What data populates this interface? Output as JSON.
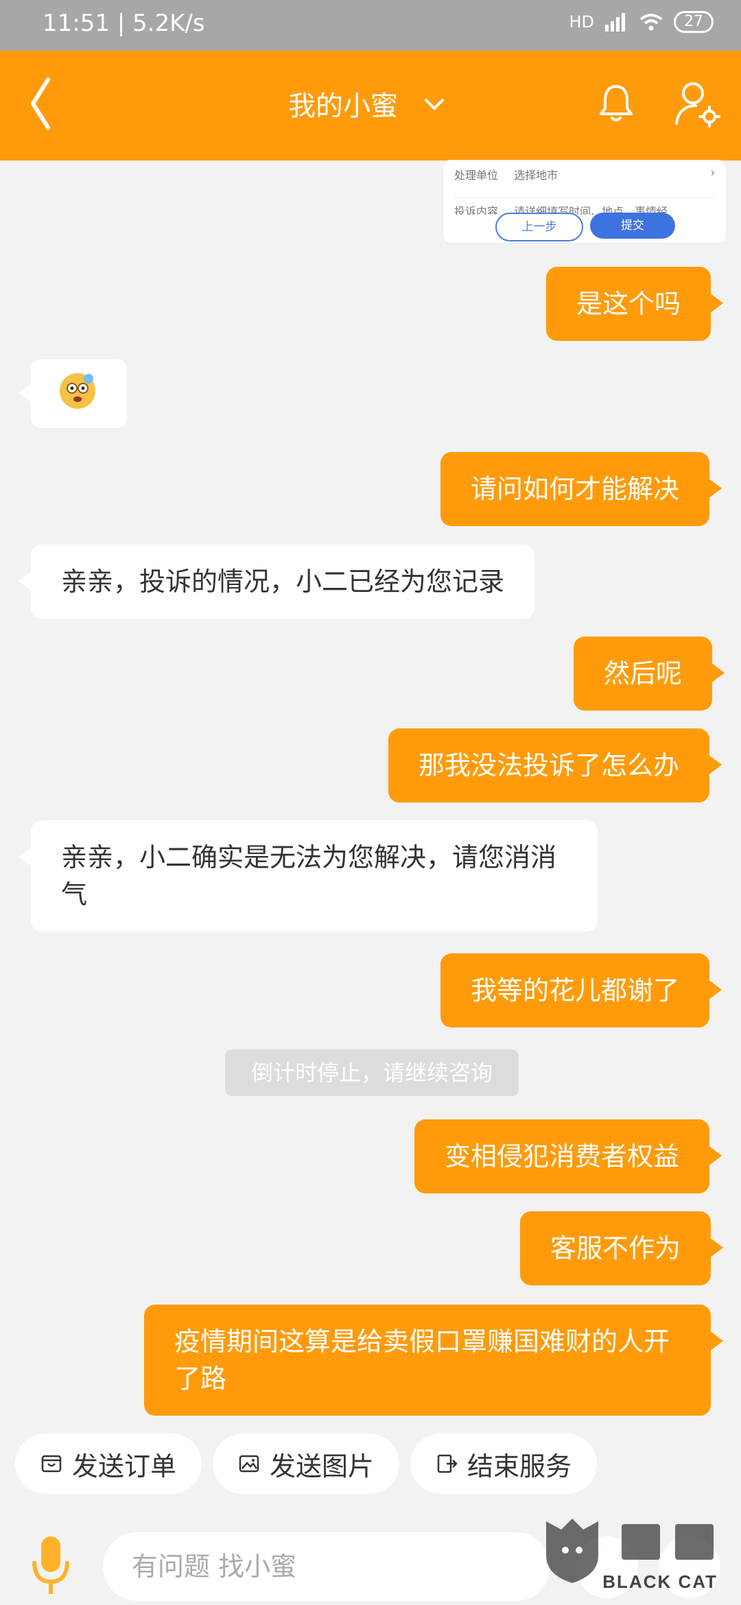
{
  "status_bar": {
    "time_speed": "11:51 | 5.2K/s",
    "battery": "27",
    "network": "HD"
  },
  "header": {
    "title": "我的小蜜",
    "icons": [
      "back-arrow-icon",
      "chevron-down-icon",
      "bell-icon",
      "user-settings-icon"
    ]
  },
  "attachment_card": {
    "rows": [
      {
        "label": "处理单位",
        "value": "选择地市",
        "arrow": "›"
      },
      {
        "label": "投诉内容",
        "value": "请详细填写时间、地点、事情经",
        "arrow": ""
      }
    ],
    "prev_button": "上一步",
    "submit_button": "提交"
  },
  "messages": [
    {
      "type": "outgoing",
      "text": "是这个吗"
    },
    {
      "type": "incoming_emoji",
      "emoji": "dizzy-face-icon"
    },
    {
      "type": "outgoing",
      "text": "请问如何才能解决"
    },
    {
      "type": "incoming",
      "text": "亲亲，投诉的情况，小二已经为您记录"
    },
    {
      "type": "outgoing",
      "text": "然后呢"
    },
    {
      "type": "outgoing",
      "text": "那我没法投诉了怎么办"
    },
    {
      "type": "incoming",
      "text": "亲亲，小二确实是无法为您解决，请您消消气"
    },
    {
      "type": "outgoing",
      "text": "我等的花儿都谢了"
    },
    {
      "type": "system",
      "text": "倒计时停止，请继续咨询"
    },
    {
      "type": "outgoing",
      "text": "变相侵犯消费者权益"
    },
    {
      "type": "outgoing",
      "text": "客服不作为"
    },
    {
      "type": "outgoing",
      "text": "疫情期间这算是给卖假口罩赚国难财的人开了路"
    }
  ],
  "quick_actions": [
    {
      "label": "发送订单",
      "icon": "order-icon"
    },
    {
      "label": "发送图片",
      "icon": "image-icon"
    },
    {
      "label": "结束服务",
      "icon": "exit-icon"
    }
  ],
  "input_bar": {
    "placeholder": "有问题 找小蜜",
    "mic_icon": "mic-icon"
  },
  "watermark": {
    "text": "BLACK CAT"
  },
  "colors": {
    "accent": "#ff9b0b",
    "background": "#f2f2f2",
    "status_bar": "#a7a7a7",
    "system_pill": "#dcdcdc"
  }
}
